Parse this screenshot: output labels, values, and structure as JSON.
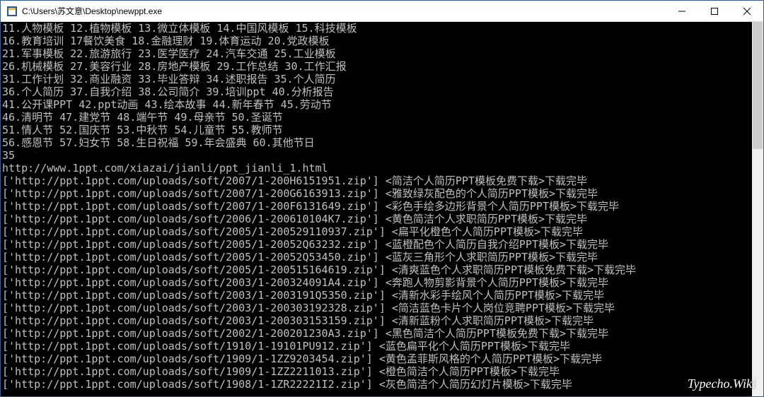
{
  "window": {
    "title": "C:\\Users\\苏文意\\Desktop\\newppt.exe"
  },
  "console": {
    "menu_lines": [
      "11.人物模板 12.植物模板 13.微立体模板 14.中国风模板 15.科技模板",
      "16.教育培训 17餐饮美食 18.金融理财 19.体育运动 20.党政模板",
      "21.军事模板 22.旅游旅行 23.医学医疗 24.汽车交通 25.工业模板",
      "26.机械模板 27.美容行业 28.房地产模板 29.工作总结 30.工作汇报",
      "31.工作计划 32.商业融资 33.毕业答辩 34.述职报告 35.个人简历",
      "36.个人简历 37.自我介绍 38.公司简介 39.培训ppt 40.分析报告",
      "41.公开课PPT 42.ppt动画 43.绘本故事 44.新年春节 45.劳动节",
      "46.清明节 47.建党节 48.端午节 49.母亲节 50.圣诞节",
      "51.情人节 52.国庆节 53.中秋节 54.儿童节 55.教师节",
      "56.感恩节 57.妇女节 58.生日祝福 59.年会盛典 60.其他节日"
    ],
    "input_value": "35",
    "source_url": "http://www.1ppt.com/xiazai/jianli/ppt_jianli_1.html",
    "downloads": [
      {
        "url": "http://ppt.1ppt.com/uploads/soft/2007/1-200H6151951.zip",
        "name": "简洁个人简历PPT模板免费下载",
        "status": "下载完毕"
      },
      {
        "url": "http://ppt.1ppt.com/uploads/soft/2007/1-200G6163913.zip",
        "name": "雅致绿灰配色的个人简历PPT模板",
        "status": "下载完毕"
      },
      {
        "url": "http://ppt.1ppt.com/uploads/soft/2007/1-200F6131649.zip",
        "name": "彩色手绘多边形背景个人简历PPT模板",
        "status": "下载完毕"
      },
      {
        "url": "http://ppt.1ppt.com/uploads/soft/2006/1-200610104K7.zip",
        "name": "黄色简洁个人求职简历PPT模板",
        "status": "下载完毕"
      },
      {
        "url": "http://ppt.1ppt.com/uploads/soft/2005/1-200529110937.zip",
        "name": "扁平化橙色个人简历PPT模板",
        "status": "下载完毕"
      },
      {
        "url": "http://ppt.1ppt.com/uploads/soft/2005/1-20052Q63232.zip",
        "name": "蓝橙配色个人简历自我介绍PPT模板",
        "status": "下载完毕"
      },
      {
        "url": "http://ppt.1ppt.com/uploads/soft/2005/1-20052Q53450.zip",
        "name": "蓝灰三角形个人求职简历PPT模板",
        "status": "下载完毕"
      },
      {
        "url": "http://ppt.1ppt.com/uploads/soft/2005/1-200515164619.zip",
        "name": "清爽蓝色个人求职简历PPT模板免费下载",
        "status": "下载完毕"
      },
      {
        "url": "http://ppt.1ppt.com/uploads/soft/2003/1-200324091A4.zip",
        "name": "奔跑人物剪影背景个人简历PPT模板",
        "status": "下载完毕"
      },
      {
        "url": "http://ppt.1ppt.com/uploads/soft/2003/1-2003191Q5350.zip",
        "name": "清新水彩手绘风个人简历PPT模板",
        "status": "下载完毕"
      },
      {
        "url": "http://ppt.1ppt.com/uploads/soft/2003/1-200303192328.zip",
        "name": "简洁蓝色卡片个人岗位竞聘PPT模板",
        "status": "下载完毕"
      },
      {
        "url": "http://ppt.1ppt.com/uploads/soft/2003/1-200303153159.zip",
        "name": "清新蓝粉个人求职简历PPT模板",
        "status": "下载完毕"
      },
      {
        "url": "http://ppt.1ppt.com/uploads/soft/2002/1-200201230A3.zip",
        "name": "黑色简洁个人简历PPT模板免费下载",
        "status": "下载完毕"
      },
      {
        "url": "http://ppt.1ppt.com/uploads/soft/1910/1-19101PU912.zip",
        "name": "蓝色扁平化个人简历PPT模板",
        "status": "下载完毕"
      },
      {
        "url": "http://ppt.1ppt.com/uploads/soft/1909/1-1ZZ9203454.zip",
        "name": "黄色孟菲斯风格的个人简历PPT模板",
        "status": "下载完毕"
      },
      {
        "url": "http://ppt.1ppt.com/uploads/soft/1909/1-1ZZ2211013.zip",
        "name": "橙色简洁个人简历PPT模板",
        "status": "下载完毕"
      },
      {
        "url": "http://ppt.1ppt.com/uploads/soft/1908/1-1ZR22221I2.zip",
        "name": "灰色简洁个人简历幻灯片模板",
        "status": "下载完毕"
      }
    ]
  },
  "watermark": "Typecho.Wiki"
}
